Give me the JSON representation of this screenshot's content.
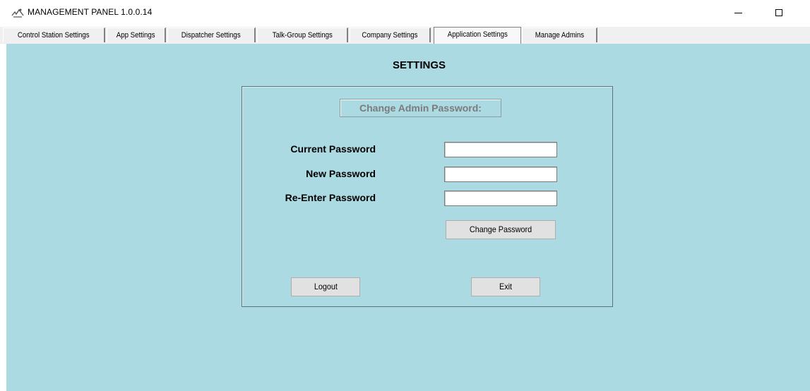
{
  "window": {
    "title": "MANAGEMENT PANEL 1.0.0.14",
    "app_icon": "app-logo-icon",
    "controls": [
      "minimize-icon",
      "maximize-icon"
    ]
  },
  "tabs": [
    {
      "label": "Control Station Settings",
      "active": false
    },
    {
      "label": "App Settings",
      "active": false
    },
    {
      "label": "Dispatcher Settings",
      "active": false
    },
    {
      "label": "Talk-Group Settings",
      "active": false
    },
    {
      "label": "Company Settings",
      "active": false
    },
    {
      "label": "Application Settings",
      "active": true
    },
    {
      "label": "Manage Admins",
      "active": false
    }
  ],
  "main": {
    "title": "SETTINGS",
    "panel": {
      "header": "Change Admin Password:",
      "fields": [
        {
          "label": "Current Password",
          "value": ""
        },
        {
          "label": "New Password",
          "value": ""
        },
        {
          "label": "Re-Enter Password",
          "value": ""
        }
      ],
      "change_button": "Change Password",
      "logout_button": "Logout",
      "exit_button": "Exit"
    }
  },
  "colors": {
    "background": "#acdae3",
    "tabstrip": "#f0f0f0",
    "button": "#e1e1e1",
    "header_text": "#7b7b7b"
  }
}
